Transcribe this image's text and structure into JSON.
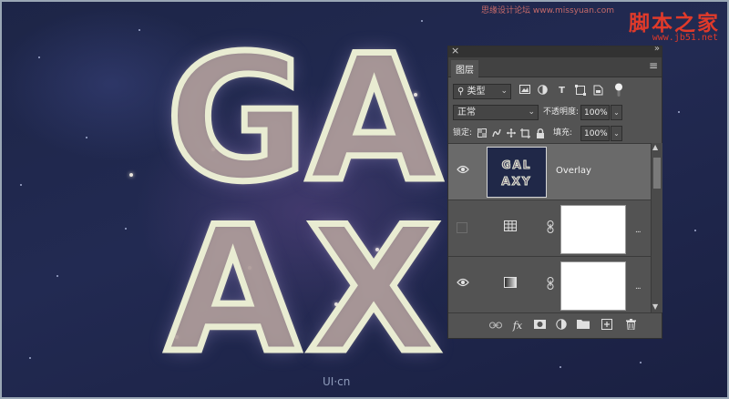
{
  "artwork": {
    "letters": [
      "G",
      "A",
      "A",
      "X"
    ],
    "credit": "UI·cn"
  },
  "watermark": {
    "site_name": "脚本之家",
    "url": "www.jb51.net",
    "small_text": "思缘设计论坛 www.missyuan.com"
  },
  "panel": {
    "close_glyph": "×",
    "collapse_glyph": "»",
    "tab_label": "图层",
    "menu_glyph": "≡",
    "filter": {
      "kind_label": "类型",
      "search_glyph": "⚲",
      "chevron": "⌄",
      "icons": [
        "image-filter-icon",
        "adjustment-filter-icon",
        "type-filter-icon",
        "shape-filter-icon",
        "smart-object-filter-icon"
      ],
      "type_glyph": "T"
    },
    "blend": {
      "mode": "正常",
      "opacity_label": "不透明度:",
      "opacity_value": "100%"
    },
    "lock": {
      "label": "锁定:",
      "fill_label": "填充:",
      "fill_value": "100%"
    },
    "layers": [
      {
        "name": "Overlay",
        "visible": true,
        "selected": true,
        "kind": "smart-object",
        "thumb_text": [
          "GAL",
          "AXY"
        ]
      },
      {
        "name": "",
        "visible": false,
        "selected": false,
        "kind": "adjustment-grid",
        "icon": "⊞",
        "link": "🔗",
        "more": "..."
      },
      {
        "name": "",
        "visible": true,
        "selected": false,
        "kind": "gradient-map",
        "icon": "◧",
        "link": "🔗",
        "more": "..."
      }
    ],
    "eye_glyph": "👁",
    "footer": {
      "fx_label": "fx",
      "link_glyph": "⛓",
      "mask_glyph": "◙",
      "adjust_glyph": "◐",
      "folder_glyph": "▬",
      "new_glyph": "❐",
      "trash_glyph": "🗑"
    },
    "scroll": {
      "up": "▲",
      "down": "▼"
    }
  }
}
